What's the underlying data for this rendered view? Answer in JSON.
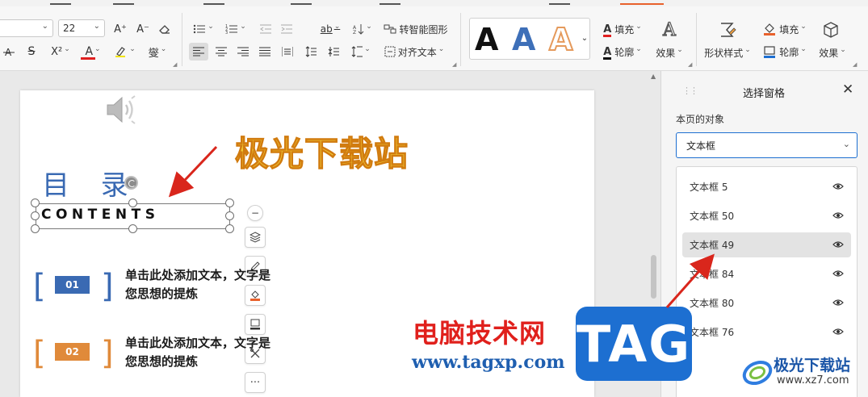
{
  "ribbon": {
    "font_size": "22",
    "grow_font_label": "A⁺",
    "shrink_font_label": "A⁻",
    "strike_label": "S",
    "superscript_label": "X²",
    "font_color_label": "A",
    "phonetic_label": "燮",
    "text_dir_label": "ab",
    "smart_graphic_label": "转智能图形",
    "align_text_label": "对齐文本",
    "fill_label": "填充",
    "outline_label": "轮廓",
    "effects_label": "效果",
    "shape_style_label": "形状样式",
    "shape_fill_label": "填充",
    "shape_outline_label": "轮廓",
    "shape_effects_label": "效果",
    "wordart_letter": "A"
  },
  "slide": {
    "watermark_title": "极光下载站",
    "title": "目 录",
    "subtitle": "CONTENTS",
    "items": [
      {
        "num": "01",
        "line1": "单击此处添加文本，文字是",
        "line2": "您思想的提炼",
        "color": "#3a6ab3"
      },
      {
        "num": "02",
        "line1": "单击此处添加文本，文字是",
        "line2": "您思想的提炼",
        "color": "#e08a3a"
      }
    ],
    "more_label": "···"
  },
  "watermarks": {
    "site_cn": "电脑技术网",
    "site_url": "www.tagxp.com",
    "tag": "TAG",
    "logo_name": "极光下载站",
    "logo_url": "www.xz7.com"
  },
  "pane": {
    "title": "选择窗格",
    "subtitle": "本页的对象",
    "filter_value": "文本框",
    "objects": [
      {
        "label": "文本框 5",
        "selected": false
      },
      {
        "label": "文本框 50",
        "selected": false
      },
      {
        "label": "文本框 49",
        "selected": true
      },
      {
        "label": "文本框 84",
        "selected": false
      },
      {
        "label": "文本框 80",
        "selected": false
      },
      {
        "label": "文本框 76",
        "selected": false
      }
    ]
  },
  "colors": {
    "accent_blue": "#1d6fd1",
    "annotation_red": "#d9261c",
    "brand_orange": "#e8612c"
  }
}
